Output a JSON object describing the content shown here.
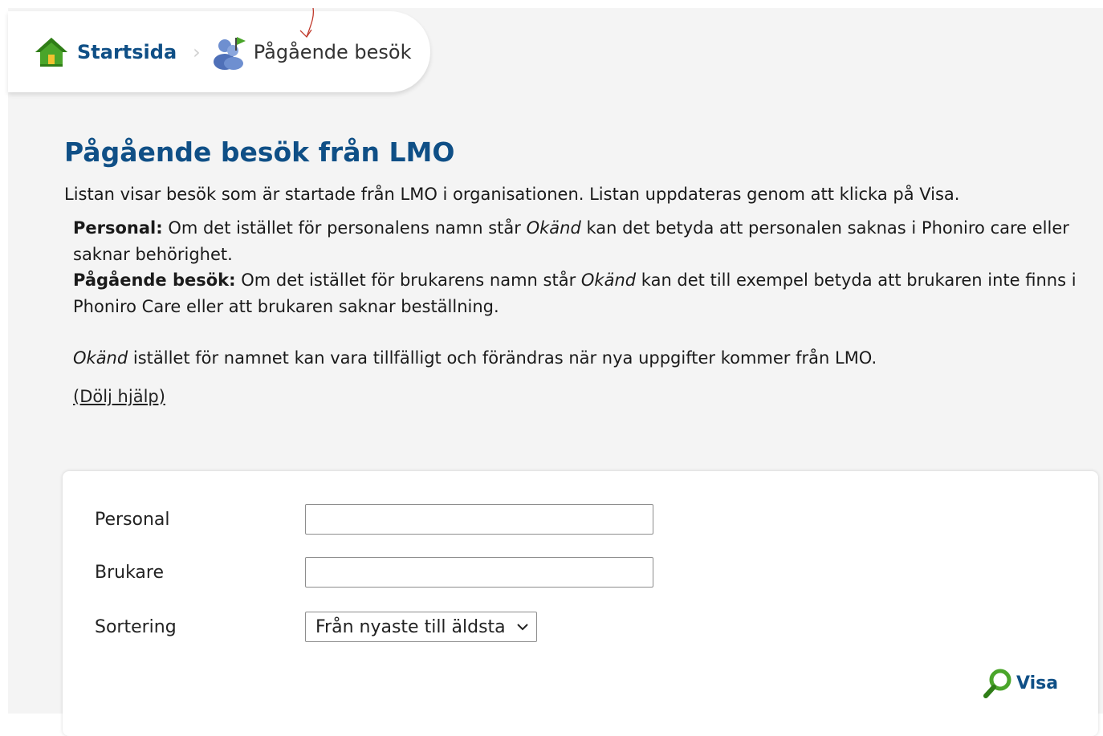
{
  "breadcrumb": {
    "home_label": "Startsida",
    "separator": "›",
    "current_label": "Pågående besök"
  },
  "main": {
    "title": "Pågående besök från LMO",
    "intro": "Listan visar besök som är startade från LMO i organisationen. Listan uppdateras genom att klicka på Visa.",
    "help": {
      "personal_heading": "Personal:",
      "personal_text_1": " Om det istället för personalens namn står ",
      "unknown_word": "Okänd",
      "personal_text_2": " kan det betyda att personalen saknas i Phoniro care eller saknar behörighet.",
      "visits_heading": "Pågående besök:",
      "visits_text_1": " Om det istället för brukarens namn står ",
      "visits_text_2": " kan det till exempel betyda att brukaren inte finns i Phoniro Care eller att brukaren saknar beställning.",
      "temporary_text": " istället för namnet kan vara tillfälligt och förändras när nya uppgifter kommer från LMO."
    },
    "hide_help_label": "(Dölj hjälp)"
  },
  "filters": {
    "personal_label": "Personal",
    "personal_value": "",
    "brukare_label": "Brukare",
    "brukare_value": "",
    "sort_label": "Sortering",
    "sort_selected": "Från nyaste till äldsta",
    "show_button_label": "Visa"
  },
  "colors": {
    "accent_blue": "#0f4f86",
    "home_icon_green": "#4aa52a",
    "search_icon_green": "#4aa52a",
    "annotation_red": "#c0392b"
  },
  "icons": {
    "home": "home-icon",
    "visit": "visit-icon",
    "chevron": "chevron-down-icon",
    "search": "search-icon"
  }
}
